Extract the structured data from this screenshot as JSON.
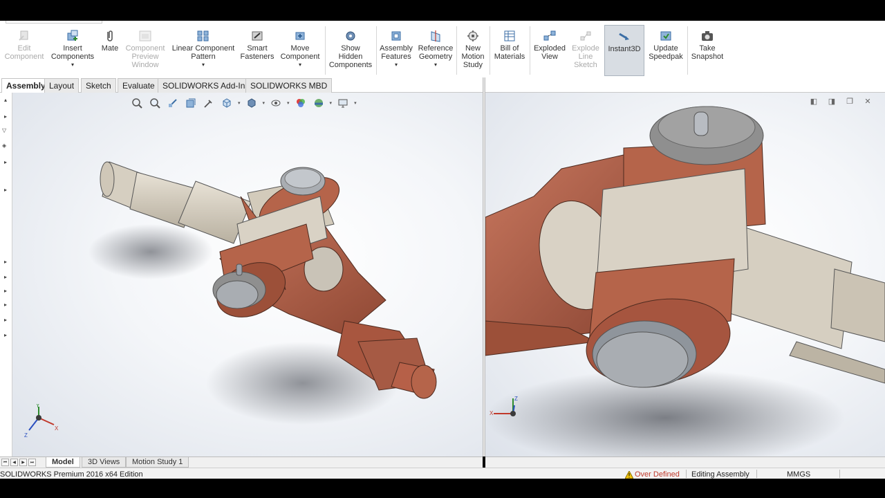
{
  "ribbon": {
    "buttons": [
      {
        "label": "Edit\nComponent",
        "icon": "edit-component-icon",
        "enabled": false,
        "caret": false
      },
      {
        "label": "Insert\nComponents",
        "icon": "insert-components-icon",
        "enabled": true,
        "caret": true
      },
      {
        "label": "Mate",
        "icon": "mate-paperclip-icon",
        "enabled": true,
        "caret": false
      },
      {
        "label": "Component\nPreview\nWindow",
        "icon": "component-preview-icon",
        "enabled": false,
        "caret": false
      },
      {
        "label": "Linear Component\nPattern",
        "icon": "linear-pattern-icon",
        "enabled": true,
        "caret": true
      },
      {
        "label": "Smart\nFasteners",
        "icon": "smart-fasteners-icon",
        "enabled": true,
        "caret": false
      },
      {
        "label": "Move\nComponent",
        "icon": "move-component-icon",
        "enabled": true,
        "caret": true
      },
      {
        "label": "Show\nHidden\nComponents",
        "icon": "show-hidden-icon",
        "enabled": true,
        "caret": false
      },
      {
        "label": "Assembly\nFeatures",
        "icon": "assembly-features-icon",
        "enabled": true,
        "caret": true
      },
      {
        "label": "Reference\nGeometry",
        "icon": "reference-geometry-icon",
        "enabled": true,
        "caret": true
      },
      {
        "label": "New\nMotion\nStudy",
        "icon": "motion-study-icon",
        "enabled": true,
        "caret": false
      },
      {
        "label": "Bill of\nMaterials",
        "icon": "bill-of-materials-icon",
        "enabled": true,
        "caret": false
      },
      {
        "label": "Exploded\nView",
        "icon": "exploded-view-icon",
        "enabled": true,
        "caret": false
      },
      {
        "label": "Explode\nLine\nSketch",
        "icon": "explode-line-sketch-icon",
        "enabled": false,
        "caret": false
      },
      {
        "label": "Instant3D",
        "icon": "instant3d-icon",
        "enabled": true,
        "caret": false,
        "active": true
      },
      {
        "label": "Update\nSpeedpak",
        "icon": "update-speedpak-icon",
        "enabled": true,
        "caret": false
      },
      {
        "label": "Take\nSnapshot",
        "icon": "camera-icon",
        "enabled": true,
        "caret": false
      }
    ]
  },
  "tabs": [
    "Assembly",
    "Layout",
    "Sketch",
    "Evaluate",
    "SOLIDWORKS Add-Ins",
    "SOLIDWORKS MBD"
  ],
  "bottom_tabs": [
    "Model",
    "3D Views",
    "Motion Study 1"
  ],
  "axes": {
    "x": "X",
    "y": "Y",
    "z": "Z"
  },
  "status": {
    "edition": "SOLIDWORKS Premium 2016 x64 Edition",
    "warning": "Over Defined",
    "mode": "Editing Assembly",
    "units": "MMGS"
  },
  "colors": {
    "copper": "#b5644a",
    "copper_dark": "#8a4533",
    "tan": "#d9d2c5",
    "pin_gray": "#a9adb2"
  }
}
